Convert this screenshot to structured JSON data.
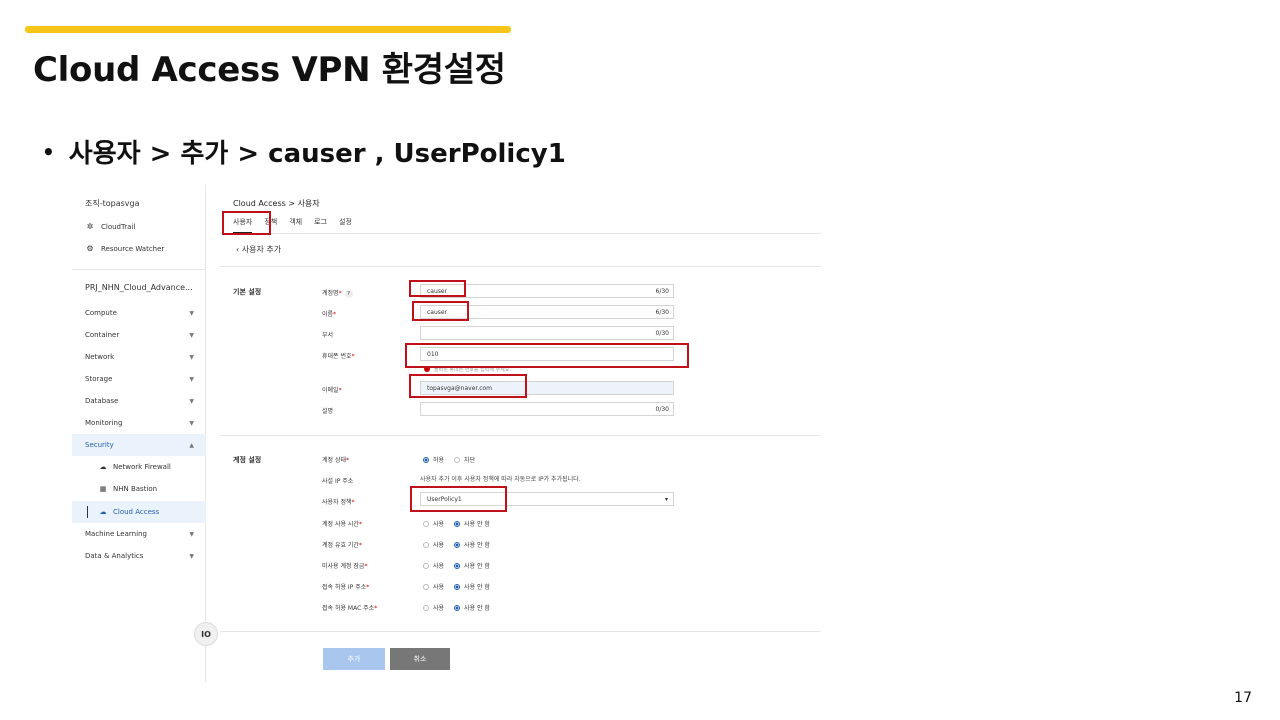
{
  "slide": {
    "title": "Cloud Access VPN 환경설정",
    "bullet": "사용자 > 추가 > causer , UserPolicy1",
    "page_number": "17",
    "accent_color": "#f5c518"
  },
  "sidebar": {
    "org": "조직-topasvga",
    "links": [
      {
        "icon": "cloudtrail-icon",
        "label": "CloudTrail"
      },
      {
        "icon": "resource-watcher-icon",
        "label": "Resource Watcher"
      }
    ],
    "project": "PRJ_NHN_Cloud_Advance...",
    "items": [
      {
        "label": "Compute"
      },
      {
        "label": "Container"
      },
      {
        "label": "Network"
      },
      {
        "label": "Storage"
      },
      {
        "label": "Database"
      },
      {
        "label": "Monitoring"
      },
      {
        "label": "Security"
      }
    ],
    "security_sub": [
      {
        "icon": "network-firewall-icon",
        "label": "Network Firewall"
      },
      {
        "icon": "bastion-icon",
        "label": "NHN Bastion"
      },
      {
        "icon": "cloud-access-icon",
        "label": "Cloud Access"
      }
    ],
    "items_after": [
      {
        "label": "Machine Learning"
      },
      {
        "label": "Data & Analytics"
      }
    ],
    "collapse_label": "IO"
  },
  "main": {
    "breadcrumb": "Cloud Access  >  사용자",
    "tabs": [
      "사용자",
      "정책",
      "객체",
      "로그",
      "설정"
    ],
    "back_label": "‹   사용자 추가",
    "basic": {
      "title": "기본 설정",
      "fields": [
        {
          "label": "계정명",
          "required": "*",
          "value": "causer",
          "count": "6/30"
        },
        {
          "label": "이름",
          "required": "*",
          "value": "causer",
          "count": "6/30"
        },
        {
          "label": "부서",
          "required": "",
          "value": "",
          "count": "0/30"
        },
        {
          "label": "휴대폰 번호",
          "required": "*",
          "value": "010",
          "count": ""
        },
        {
          "label": "이메일",
          "required": "*",
          "value": "topasvga@naver.com",
          "count": ""
        },
        {
          "label": "설명",
          "required": "",
          "value": "",
          "count": "0/30"
        }
      ],
      "error_text": "올바른 휴대폰 번호를 입력해 주세요."
    },
    "account": {
      "title": "계정 설정",
      "status_label": "계정 상태",
      "status_options": [
        "허용",
        "차단"
      ],
      "ip_label": "사설 IP 주소",
      "ip_note": "사용자 추가 이후 사용자 정책에 따라 자동으로 IP가 추가됩니다.",
      "policy_label": "사용자 정책",
      "policy_value": "UserPolicy1",
      "options": [
        {
          "label": "계정 사용 시간"
        },
        {
          "label": "계정 유효 기간"
        },
        {
          "label": "미사용 계정 잠금"
        },
        {
          "label": "접속 허용 IP 주소"
        },
        {
          "label": "접속 허용 MAC 주소"
        }
      ],
      "use": "사용",
      "not_use": "사용 안 함"
    },
    "add_button": "추가",
    "cancel_button": "취소",
    "req_mark": "*"
  }
}
